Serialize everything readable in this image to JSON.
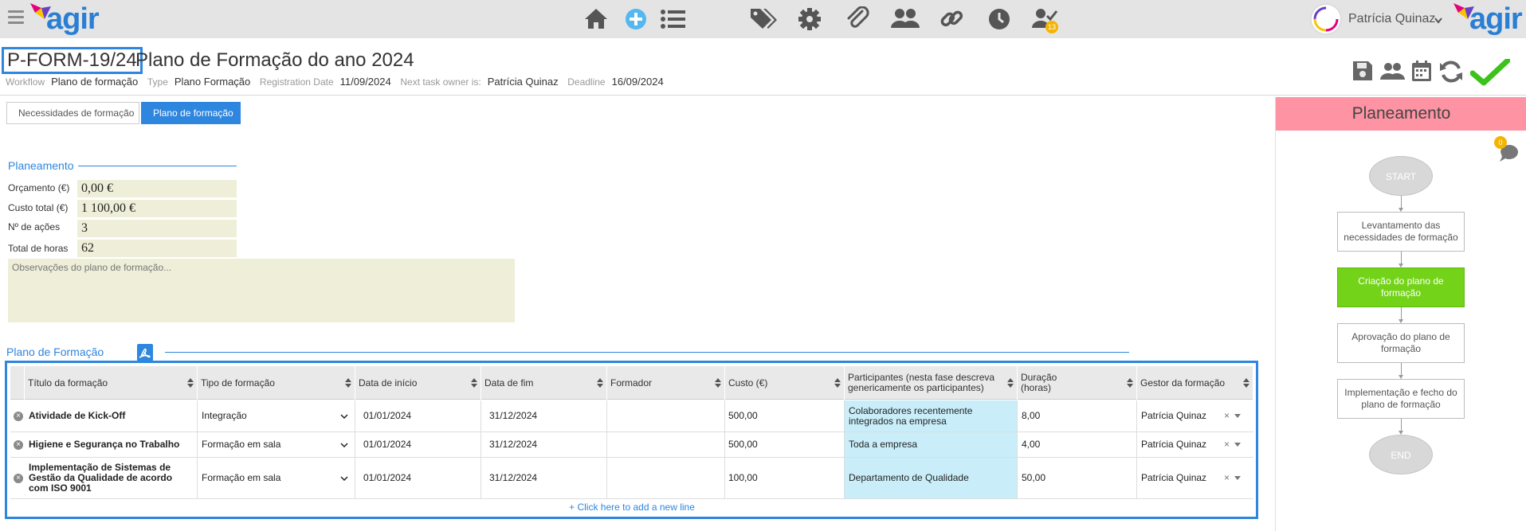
{
  "app": {
    "brand": "agir",
    "user_name": "Patrícia Quinaz",
    "tasks_badge": "13"
  },
  "nav_icons": [
    "home-icon",
    "add-circle-icon",
    "list-icon",
    "tags-icon",
    "gear-icon",
    "paperclip-icon",
    "users-icon",
    "link-icon",
    "clock-icon",
    "user-check-icon"
  ],
  "header": {
    "form_id": "P-FORM-19/24",
    "title": "Plano de Formação do ano 2024",
    "workflow_label": "Workflow",
    "workflow_value": "Plano de formação",
    "type_label": "Type",
    "type_value": "Plano Formação",
    "regdate_label": "Registration Date",
    "regdate_value": "11/09/2024",
    "owner_label": "Next task owner is:",
    "owner_value": "Patrícia Quinaz",
    "deadline_label": "Deadline",
    "deadline_value": "16/09/2024"
  },
  "tabs": [
    {
      "label": "Necessidades de formação",
      "active": false
    },
    {
      "label": "Plano de formação",
      "active": true
    }
  ],
  "planeamento": {
    "section_title": "Planeamento",
    "orcamento_label": "Orçamento (€)",
    "orcamento_value": "0,00 €",
    "custo_label": "Custo total (€)",
    "custo_value": "1 100,00 €",
    "acoes_label": "Nº de ações",
    "acoes_value": "3",
    "horas_label": "Total de horas",
    "horas_value": "62",
    "notes_placeholder": "Observações do plano de formação..."
  },
  "plano": {
    "section_title": "Plano de Formação",
    "columns": [
      "Título da formação",
      "Tipo de formação",
      "Data de início",
      "Data de fim",
      "Formador",
      "Custo (€)",
      "Participantes (nesta fase descreva genericamente os participantes)",
      "Duração (horas)",
      "Gestor da formação"
    ],
    "rows": [
      {
        "titulo": "Atividade de Kick-Off",
        "tipo": "Integração",
        "inicio": "01/01/2024",
        "fim": "31/12/2024",
        "formador": "",
        "custo": "500,00",
        "participantes": "Colaboradores recentemente integrados na empresa",
        "duracao": "8,00",
        "gestor": "Patrícia Quinaz"
      },
      {
        "titulo": "Higiene e Segurança no Trabalho",
        "tipo": "Formação em sala",
        "inicio": "01/01/2024",
        "fim": "31/12/2024",
        "formador": "",
        "custo": "500,00",
        "participantes": "Toda a empresa",
        "duracao": "4,00",
        "gestor": "Patrícia Quinaz"
      },
      {
        "titulo": "Implementação de Sistemas de Gestão da Qualidade de acordo com ISO 9001",
        "tipo": "Formação em sala",
        "inicio": "01/01/2024",
        "fim": "31/12/2024",
        "formador": "",
        "custo": "100,00",
        "participantes": "Departamento de Qualidade",
        "duracao": "50,00",
        "gestor": "Patrícia Quinaz"
      }
    ],
    "add_line": "+ Click here to add a new line"
  },
  "sidebar": {
    "stage": "Planeamento",
    "comments_badge": "0",
    "workflow": {
      "start": "START",
      "end": "END",
      "steps": [
        {
          "label": "Levantamento das necessidades de formação",
          "current": false
        },
        {
          "label": "Criação do plano de formação",
          "current": true
        },
        {
          "label": "Aprovação do plano de formação",
          "current": false
        },
        {
          "label": "Implementação e fecho do plano de formação",
          "current": false
        }
      ]
    }
  },
  "colors": {
    "accent": "#2e86de",
    "stage_header": "#fd93a3",
    "current_step": "#73d318",
    "field_bg": "#eeeed9",
    "participants_bg": "#c9eefa",
    "badge": "#f4b400"
  }
}
